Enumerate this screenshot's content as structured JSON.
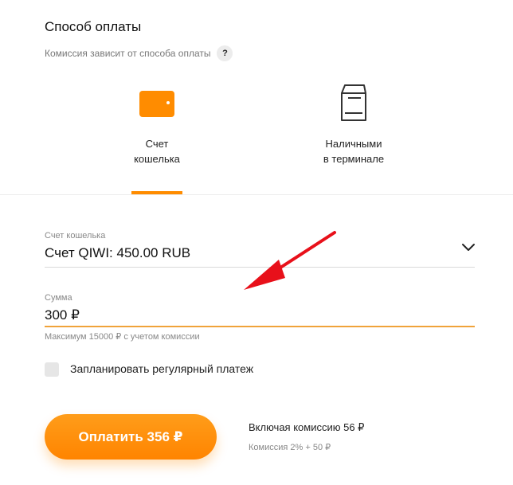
{
  "header": {
    "title": "Способ оплаты",
    "subtitle": "Комиссия зависит от способа оплаты",
    "help_symbol": "?"
  },
  "methods": [
    {
      "line1": "Счет",
      "line2": "кошелька",
      "icon": "wallet-icon",
      "active": true
    },
    {
      "line1": "Наличными",
      "line2": "в терминале",
      "icon": "terminal-icon",
      "active": false
    }
  ],
  "source": {
    "label": "Счет кошелька",
    "value": "Счет QIWI: 450.00 RUB",
    "icon": "chevron-down-icon"
  },
  "amount": {
    "label": "Сумма",
    "value": "300 ₽",
    "hint": "Максимум 15000 ₽ с учетом комиссии"
  },
  "recurring": {
    "label": "Запланировать регулярный платеж",
    "checked": false
  },
  "pay": {
    "button_label": "Оплатить 356 ₽",
    "commission_total": "Включая комиссию 56 ₽",
    "commission_rate": "Комиссия 2% + 50 ₽"
  },
  "colors": {
    "accent": "#ff8c00",
    "annotation_arrow": "#e8101a"
  }
}
